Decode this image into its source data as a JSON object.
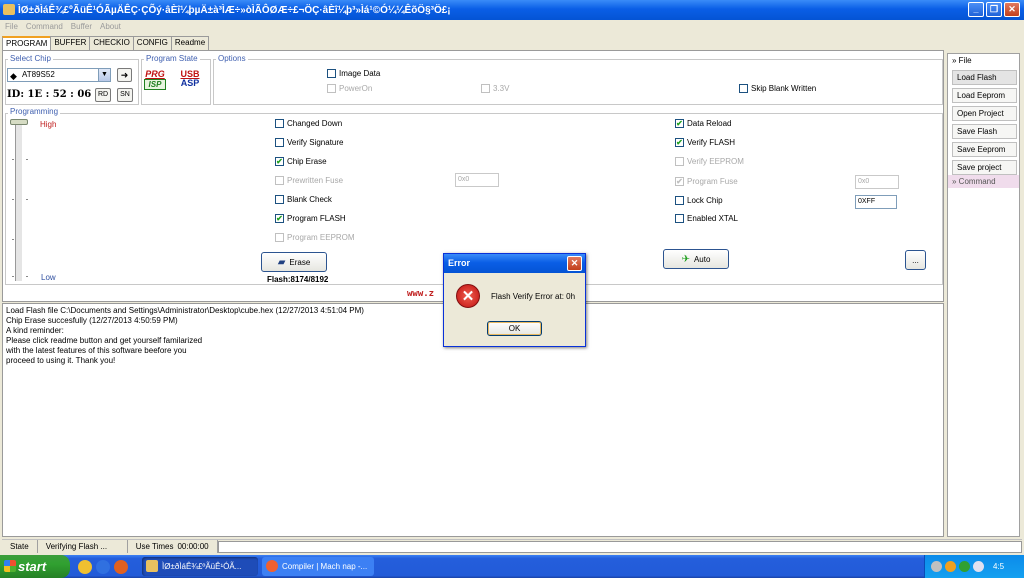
{
  "window": {
    "title": "ÌØ±ðÌáÊ¾£ºÃüÊ¹ÓÃµÄÊÇ·ÇÕý·âÈî¼þµÄ±à³ÌÆ÷»òÌÃÔØÆ÷£¬ÖÇ·âÈî¼þ³»Ìá¹©Ó¼¼ÊõÖ§³Ö£¡",
    "controls": [
      "_",
      "❐",
      "✕"
    ]
  },
  "menu": [
    "File",
    "Command",
    "Buffer",
    "About"
  ],
  "tabs": [
    "PROGRAM",
    "BUFFER",
    "CHECKIO",
    "CONFIG",
    "Readme"
  ],
  "select_chip": {
    "label": "Select Chip",
    "chip": "AT89S52",
    "id_label": "ID:",
    "id_value": "1E : 52 : 06",
    "rd_label": "RD",
    "sn_label": "SN"
  },
  "program_state": {
    "label": "Program State",
    "prg_label": "PRG",
    "isp_label": "ISP",
    "usb_label": "USB",
    "asp_label": "ASP"
  },
  "options": {
    "label": "Options",
    "image_data": "Image Data",
    "power_on": "PowerOn",
    "v33": "3.3V",
    "skip_blank": "Skip Blank Written"
  },
  "programming": {
    "label": "Programming",
    "high": "High",
    "low": "Low",
    "left_options": [
      {
        "label": "Changed Down",
        "checked": false,
        "disabled": false
      },
      {
        "label": "Verify Signature",
        "checked": false,
        "disabled": false
      },
      {
        "label": "Chip Erase",
        "checked": true,
        "disabled": false
      },
      {
        "label": "Prewritten Fuse",
        "checked": false,
        "disabled": true
      },
      {
        "label": "Blank Check",
        "checked": false,
        "disabled": false
      },
      {
        "label": "Program FLASH",
        "checked": true,
        "disabled": false
      },
      {
        "label": "Program EEPROM",
        "checked": false,
        "disabled": true
      }
    ],
    "right_options": [
      {
        "label": "Data Reload",
        "checked": true,
        "disabled": false
      },
      {
        "label": "Verify FLASH",
        "checked": true,
        "disabled": false
      },
      {
        "label": "Verify EEPROM",
        "checked": false,
        "disabled": true
      },
      {
        "label": "Program Fuse",
        "checked": true,
        "disabled": true
      },
      {
        "label": "Lock Chip",
        "checked": false,
        "disabled": false
      },
      {
        "label": "Enabled XTAL",
        "checked": false,
        "disabled": false
      }
    ],
    "prewritten_fuse_value": "0x0",
    "program_fuse_value": "0x0",
    "lock_chip_value": "0XFF",
    "erase_label": "Erase",
    "auto_label": "Auto",
    "more_label": "...",
    "flash_status": "Flash:8174/8192",
    "www_text": "www.z"
  },
  "log_lines": [
    "Load Flash file C:\\Documents and Settings\\Administrator\\Desktop\\cube.hex (12/27/2013 4:51:04 PM)",
    "Chip Erase succesfully (12/27/2013 4:50:59 PM)",
    "A kind reminder:",
    "Please click readme button and get yourself familarized",
    "with the latest features of this software beefore you",
    "proceed to using it. Thank you!"
  ],
  "status": {
    "state_label": "State",
    "state_value": "Verifying Flash ...",
    "use_times_label": "Use Times",
    "use_times_value": "00:00:00"
  },
  "sidebar": {
    "file_header": "» File",
    "buttons": [
      "Load Flash",
      "Load Eeprom",
      "Open Project",
      "Save Flash",
      "Save Eeprom",
      "Save project"
    ],
    "command_header": "» Command"
  },
  "dialog": {
    "title": "Error",
    "message": "Flash Verify Error at: 0h",
    "ok": "OK",
    "close": "✕",
    "icon": "✕"
  },
  "taskbar": {
    "start": "start",
    "tasks": [
      "ÌØ±ðÌáÊ¾£ºÃüÊ¹ÓÃ...",
      "Compiler | Mach nap -..."
    ],
    "clock": "4:5"
  }
}
